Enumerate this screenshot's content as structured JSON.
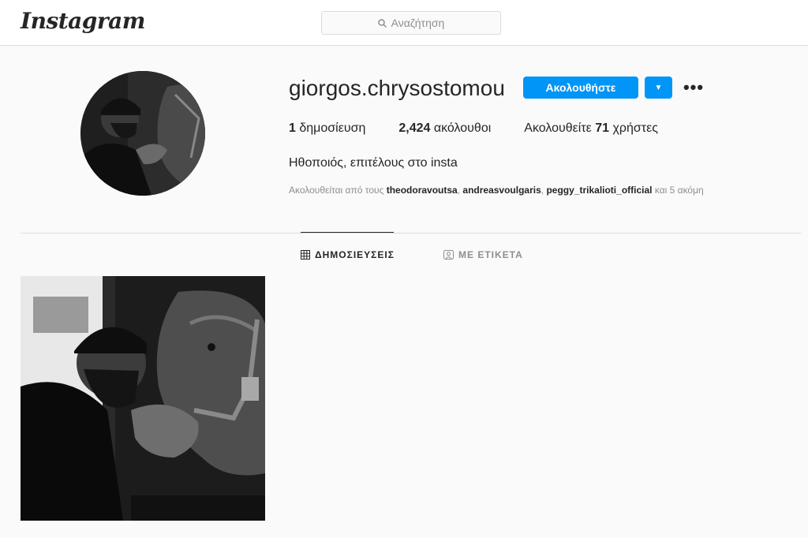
{
  "header": {
    "logo": "Instagram",
    "search_placeholder": "Αναζήτηση"
  },
  "profile": {
    "username": "giorgos.chrysostomou",
    "follow_label": "Ακολουθήστε",
    "stats": {
      "posts_count": "1",
      "posts_label": "δημοσίευση",
      "followers_count": "2,424",
      "followers_label": "ακόλουθοι",
      "following_prefix": "Ακολουθείτε",
      "following_count": "71",
      "following_suffix": "χρήστες"
    },
    "bio": "Ηθοποιός, επιτέλους στο insta",
    "followed_by": {
      "prefix": "Ακολουθείται από τους",
      "users": [
        "theodoravoutsa",
        "andreasvoulgaris",
        "peggy_trikalioti_official"
      ],
      "suffix": "και 5 ακόμη"
    }
  },
  "tabs": {
    "posts": "ΔΗΜΟΣΙΕΥΣΕΙΣ",
    "tagged": "ΜΕ ΕΤΙΚΕΤΑ"
  },
  "icons": {
    "search": "search-icon",
    "grid": "grid-icon",
    "tagged": "tag-user-icon",
    "dropdown": "caret-down-icon",
    "more": "more-options-icon"
  },
  "colors": {
    "accent": "#0095f6",
    "border": "#dbdbdb",
    "background": "#fafafa"
  }
}
